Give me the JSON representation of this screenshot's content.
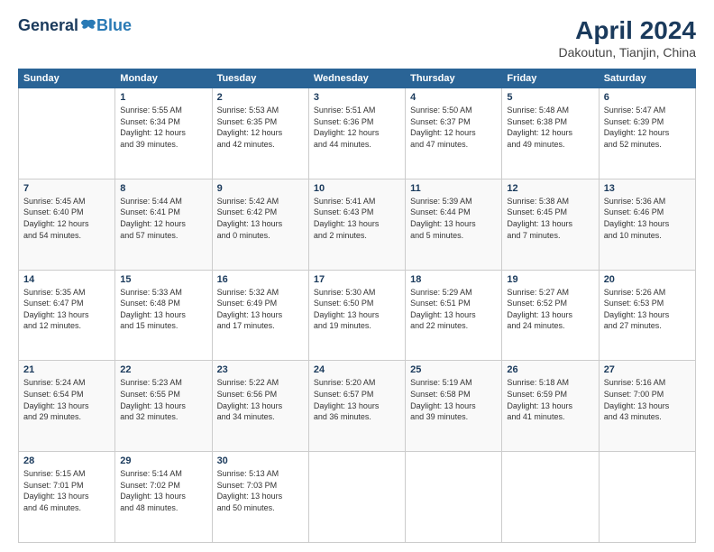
{
  "header": {
    "logo_general": "General",
    "logo_blue": "Blue",
    "title": "April 2024",
    "subtitle": "Dakoutun, Tianjin, China"
  },
  "calendar": {
    "days_of_week": [
      "Sunday",
      "Monday",
      "Tuesday",
      "Wednesday",
      "Thursday",
      "Friday",
      "Saturday"
    ],
    "weeks": [
      [
        {
          "day": "",
          "info": ""
        },
        {
          "day": "1",
          "info": "Sunrise: 5:55 AM\nSunset: 6:34 PM\nDaylight: 12 hours\nand 39 minutes."
        },
        {
          "day": "2",
          "info": "Sunrise: 5:53 AM\nSunset: 6:35 PM\nDaylight: 12 hours\nand 42 minutes."
        },
        {
          "day": "3",
          "info": "Sunrise: 5:51 AM\nSunset: 6:36 PM\nDaylight: 12 hours\nand 44 minutes."
        },
        {
          "day": "4",
          "info": "Sunrise: 5:50 AM\nSunset: 6:37 PM\nDaylight: 12 hours\nand 47 minutes."
        },
        {
          "day": "5",
          "info": "Sunrise: 5:48 AM\nSunset: 6:38 PM\nDaylight: 12 hours\nand 49 minutes."
        },
        {
          "day": "6",
          "info": "Sunrise: 5:47 AM\nSunset: 6:39 PM\nDaylight: 12 hours\nand 52 minutes."
        }
      ],
      [
        {
          "day": "7",
          "info": "Sunrise: 5:45 AM\nSunset: 6:40 PM\nDaylight: 12 hours\nand 54 minutes."
        },
        {
          "day": "8",
          "info": "Sunrise: 5:44 AM\nSunset: 6:41 PM\nDaylight: 12 hours\nand 57 minutes."
        },
        {
          "day": "9",
          "info": "Sunrise: 5:42 AM\nSunset: 6:42 PM\nDaylight: 13 hours\nand 0 minutes."
        },
        {
          "day": "10",
          "info": "Sunrise: 5:41 AM\nSunset: 6:43 PM\nDaylight: 13 hours\nand 2 minutes."
        },
        {
          "day": "11",
          "info": "Sunrise: 5:39 AM\nSunset: 6:44 PM\nDaylight: 13 hours\nand 5 minutes."
        },
        {
          "day": "12",
          "info": "Sunrise: 5:38 AM\nSunset: 6:45 PM\nDaylight: 13 hours\nand 7 minutes."
        },
        {
          "day": "13",
          "info": "Sunrise: 5:36 AM\nSunset: 6:46 PM\nDaylight: 13 hours\nand 10 minutes."
        }
      ],
      [
        {
          "day": "14",
          "info": "Sunrise: 5:35 AM\nSunset: 6:47 PM\nDaylight: 13 hours\nand 12 minutes."
        },
        {
          "day": "15",
          "info": "Sunrise: 5:33 AM\nSunset: 6:48 PM\nDaylight: 13 hours\nand 15 minutes."
        },
        {
          "day": "16",
          "info": "Sunrise: 5:32 AM\nSunset: 6:49 PM\nDaylight: 13 hours\nand 17 minutes."
        },
        {
          "day": "17",
          "info": "Sunrise: 5:30 AM\nSunset: 6:50 PM\nDaylight: 13 hours\nand 19 minutes."
        },
        {
          "day": "18",
          "info": "Sunrise: 5:29 AM\nSunset: 6:51 PM\nDaylight: 13 hours\nand 22 minutes."
        },
        {
          "day": "19",
          "info": "Sunrise: 5:27 AM\nSunset: 6:52 PM\nDaylight: 13 hours\nand 24 minutes."
        },
        {
          "day": "20",
          "info": "Sunrise: 5:26 AM\nSunset: 6:53 PM\nDaylight: 13 hours\nand 27 minutes."
        }
      ],
      [
        {
          "day": "21",
          "info": "Sunrise: 5:24 AM\nSunset: 6:54 PM\nDaylight: 13 hours\nand 29 minutes."
        },
        {
          "day": "22",
          "info": "Sunrise: 5:23 AM\nSunset: 6:55 PM\nDaylight: 13 hours\nand 32 minutes."
        },
        {
          "day": "23",
          "info": "Sunrise: 5:22 AM\nSunset: 6:56 PM\nDaylight: 13 hours\nand 34 minutes."
        },
        {
          "day": "24",
          "info": "Sunrise: 5:20 AM\nSunset: 6:57 PM\nDaylight: 13 hours\nand 36 minutes."
        },
        {
          "day": "25",
          "info": "Sunrise: 5:19 AM\nSunset: 6:58 PM\nDaylight: 13 hours\nand 39 minutes."
        },
        {
          "day": "26",
          "info": "Sunrise: 5:18 AM\nSunset: 6:59 PM\nDaylight: 13 hours\nand 41 minutes."
        },
        {
          "day": "27",
          "info": "Sunrise: 5:16 AM\nSunset: 7:00 PM\nDaylight: 13 hours\nand 43 minutes."
        }
      ],
      [
        {
          "day": "28",
          "info": "Sunrise: 5:15 AM\nSunset: 7:01 PM\nDaylight: 13 hours\nand 46 minutes."
        },
        {
          "day": "29",
          "info": "Sunrise: 5:14 AM\nSunset: 7:02 PM\nDaylight: 13 hours\nand 48 minutes."
        },
        {
          "day": "30",
          "info": "Sunrise: 5:13 AM\nSunset: 7:03 PM\nDaylight: 13 hours\nand 50 minutes."
        },
        {
          "day": "",
          "info": ""
        },
        {
          "day": "",
          "info": ""
        },
        {
          "day": "",
          "info": ""
        },
        {
          "day": "",
          "info": ""
        }
      ]
    ]
  }
}
